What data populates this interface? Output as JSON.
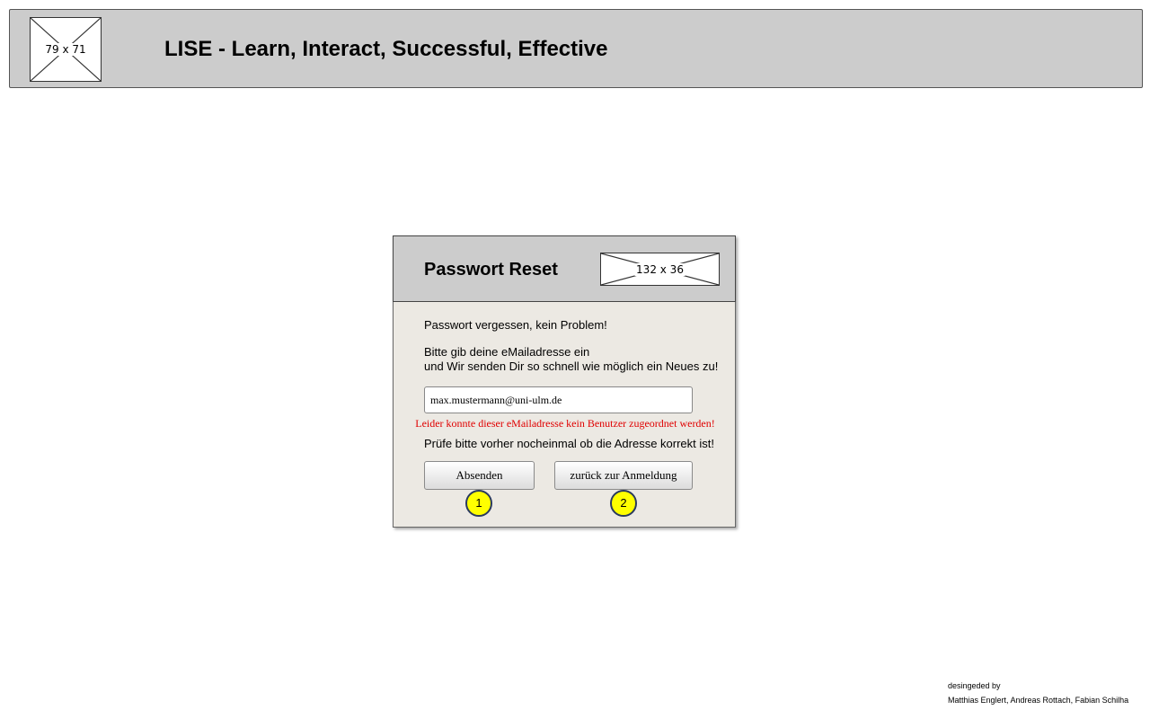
{
  "header": {
    "logo_placeholder": "79 x 71",
    "title": "LISE - Learn, Interact, Successful, Effective"
  },
  "dialog": {
    "title": "Passwort Reset",
    "logo_placeholder": "132 x 36",
    "intro": "Passwort vergessen, kein Problem!",
    "instruction_line1": "Bitte gib deine eMailadresse ein",
    "instruction_line2": "und Wir senden Dir so schnell wie möglich ein Neues zu!",
    "email_value": "max.mustermann@uni-ulm.de",
    "error_message": "Leider konnte dieser eMailadresse kein Benutzer zugeordnet werden!",
    "check_hint": "Prüfe bitte vorher nocheinmal ob die Adresse korrekt ist!",
    "submit_label": "Absenden",
    "back_label": "zurück zur Anmeldung",
    "marker_1": "1",
    "marker_2": "2"
  },
  "credits": {
    "by": "desingeded by",
    "names": "Matthias Englert, Andreas Rottach, Fabian Schilha"
  },
  "colors": {
    "header_bg": "#cccccc",
    "dialog_bg": "#ece9e3",
    "error": "#e00000",
    "marker": "#ffff00"
  }
}
